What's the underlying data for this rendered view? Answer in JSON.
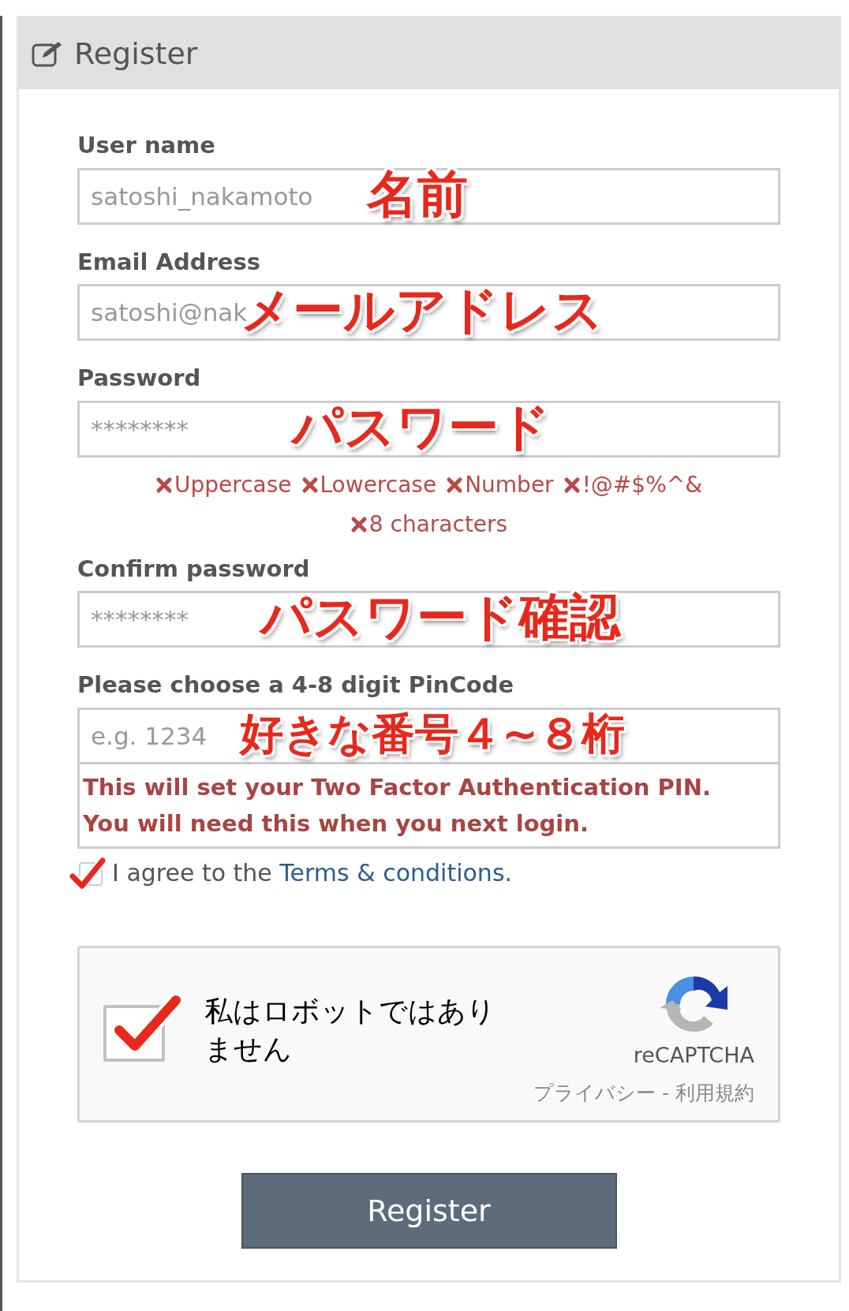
{
  "panel": {
    "title": "Register"
  },
  "fields": [
    {
      "label": "User name",
      "placeholder": "satoshi_nakamoto",
      "annotation": "名前"
    },
    {
      "label": "Email Address",
      "placeholder": "satoshi@nak",
      "annotation": "メールアドレス"
    },
    {
      "label": "Password",
      "placeholder": "********",
      "annotation": "パスワード",
      "requirements": [
        {
          "text": "Uppercase",
          "met": false
        },
        {
          "text": "Lowercase",
          "met": false
        },
        {
          "text": "Number",
          "met": false
        },
        {
          "text": "!@#$%^&",
          "met": false
        },
        {
          "text": "8 characters",
          "met": false
        }
      ]
    },
    {
      "label": "Confirm password",
      "placeholder": "********",
      "annotation": "パスワード確認"
    },
    {
      "label": "Please choose a 4-8 digit PinCode",
      "placeholder": "e.g. 1234",
      "annotation": "好きな番号４~８桁",
      "help": [
        "This will set your Two Factor Authentication PIN.",
        "You will need this when you next login."
      ]
    }
  ],
  "agree": {
    "checked": true,
    "text": "I agree to the",
    "link": "Terms & conditions",
    "after": "."
  },
  "captcha": {
    "checked": true,
    "text": "私はロボットではありません",
    "brand": "reCAPTCHA",
    "footer": "プライバシー - 利用規約"
  },
  "submit": "Register"
}
